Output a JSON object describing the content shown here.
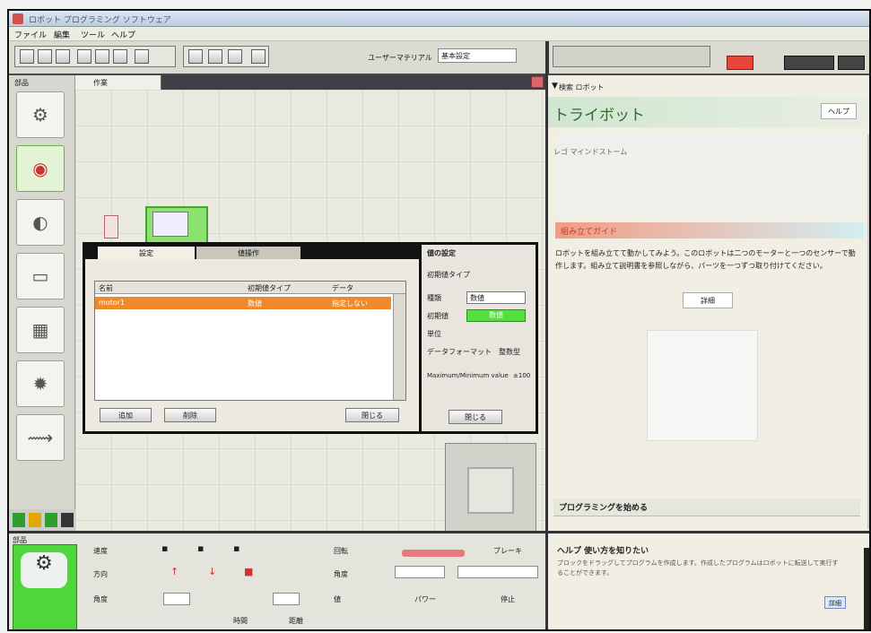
{
  "window": {
    "title": "ロボット プログラミング ソフトウェア"
  },
  "menu": [
    "ファイル",
    "編集",
    "ツール",
    "ヘルプ"
  ],
  "toolbar": {
    "label": "ユーザーマテリアル",
    "value": "基本設定"
  },
  "palette": {
    "header": "部品",
    "items": [
      {
        "name": "motor",
        "glyph": "⚙",
        "active": false
      },
      {
        "name": "sensor",
        "glyph": "◉",
        "active": true
      },
      {
        "name": "wheel",
        "glyph": "◐",
        "active": false
      },
      {
        "name": "panel",
        "glyph": "▭",
        "active": false
      },
      {
        "name": "controller",
        "glyph": "▦",
        "active": false
      },
      {
        "name": "gear",
        "glyph": "✹",
        "active": false
      },
      {
        "name": "arm",
        "glyph": "⟿",
        "active": false
      }
    ]
  },
  "workspace": {
    "tab_label": "作業"
  },
  "dialog": {
    "tabs": [
      "設定",
      "値操作"
    ],
    "columns": [
      "名前",
      "初期値タイプ",
      "データ"
    ],
    "rows": [
      [
        "motor1",
        "数値",
        "指定しない"
      ]
    ],
    "buttons": {
      "add": "追加",
      "delete": "削除",
      "close": "閉じる"
    },
    "props": {
      "header": "値の設定",
      "sub": "初期値タイプ",
      "type_label": "種類",
      "type_value": "数値",
      "value_label": "初期値",
      "value_value": "数値",
      "unit_label": "単位",
      "param1_label": "データフォーマット",
      "param1_value": "整数型",
      "param2_label": "Maximum/Minimum value",
      "param2_value": "±100",
      "ok_button": "閉じる"
    }
  },
  "bottom": {
    "title": "部品",
    "labels": [
      "速度",
      "方向",
      "角度",
      "回転",
      "角度",
      "値",
      "パワー",
      "ブレーキ",
      "停止",
      "時間",
      "距離"
    ]
  },
  "right_panel": {
    "breadcrumb": "検索 ロボット",
    "title": "トライボット",
    "help_button": "ヘルプ",
    "caption": "レゴ マインドストーム",
    "section": "組み立てガイド",
    "description": "ロボットを組み立てて動かしてみよう。このロボットは二つのモーターと一つのセンサーで動作します。組み立て説明書を参照しながら、パーツを一つずつ取り付けてください。",
    "button": "詳細",
    "section2": "プログラミングを始める"
  },
  "help_area": {
    "question": "ヘルプ 使い方を知りたい",
    "answer": "ブロックをドラッグしてプログラムを作成します。作成したプログラムはロボットに転送して実行することができます。",
    "more": "詳細"
  },
  "colors": {
    "accent_orange": "#ef8a2c",
    "accent_green": "#4fd63a",
    "accent_red": "#e84638"
  }
}
